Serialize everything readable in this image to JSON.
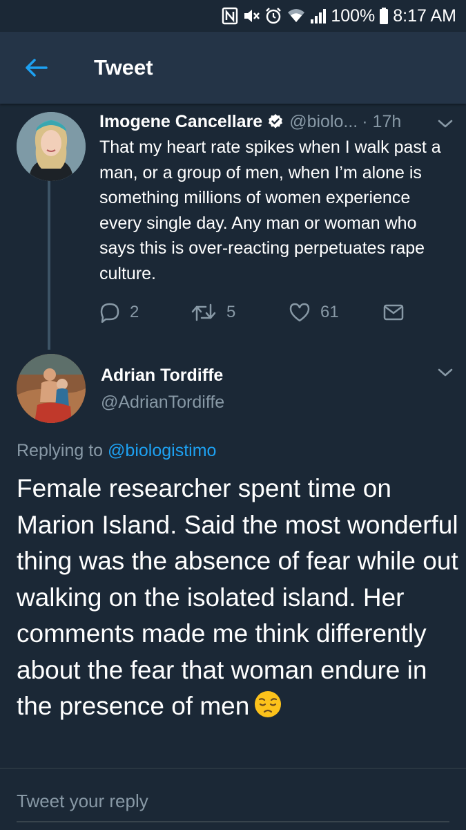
{
  "status_bar": {
    "battery": "100%",
    "time": "8:17 AM",
    "icons": [
      "nfc-icon",
      "mute-icon",
      "alarm-icon",
      "wifi-icon",
      "signal-icon",
      "battery-icon"
    ]
  },
  "app_bar": {
    "title": "Tweet",
    "back_icon": "back-arrow-icon"
  },
  "parent_tweet": {
    "name": "Imogene Cancellare",
    "handle": "@biolo...",
    "time": "· 17h",
    "verified": true,
    "text": "That my heart rate spikes when I walk past a man, or a group of men, when I’m alone is something millions of women experience every single day. Any man or woman who says this is over-reacting perpetuates rape culture.",
    "replies": "2",
    "retweets": "5",
    "likes": "61"
  },
  "main_tweet": {
    "name": "Adrian Tordiffe",
    "handle": "@AdrianTordiffe",
    "replying_prefix": "Replying to",
    "replying_to": "@biologistimo",
    "text": "Female researcher spent time on Marion Island. Said the most wonderful thing was the absence of fear while out walking on the isolated island. Her comments made me think differently about the fear that woman endure in the presence of men",
    "emoji": "pensive-face-icon"
  },
  "reply_box": {
    "placeholder": "Tweet your reply"
  },
  "colors": {
    "background": "#1b2836",
    "app_bar": "#243447",
    "accent": "#1da1f2",
    "secondary_text": "#8899a6"
  }
}
